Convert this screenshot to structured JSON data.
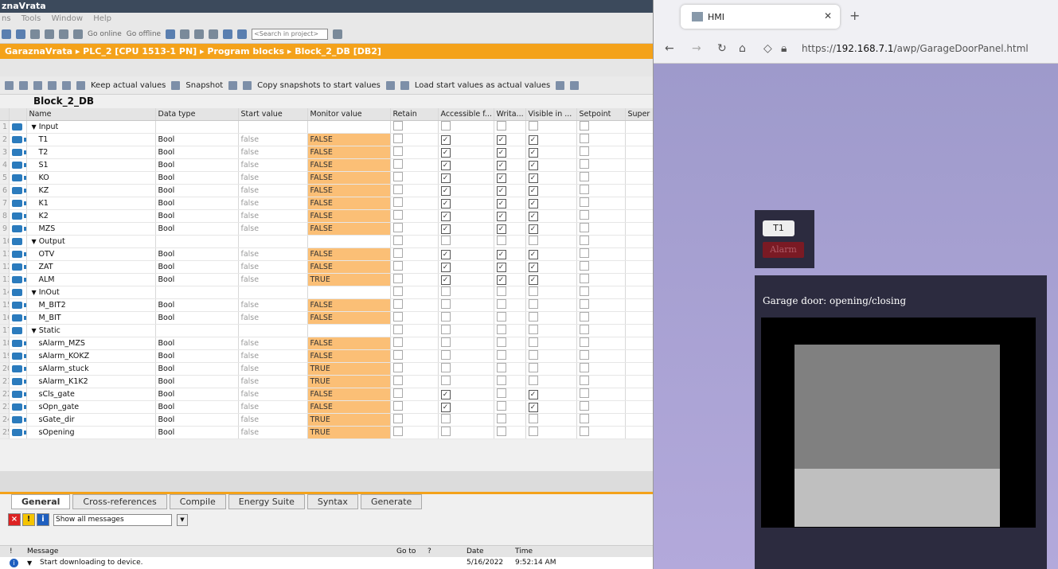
{
  "tia": {
    "title": "znaVrata",
    "menu": [
      "ns",
      "Tools",
      "Window",
      "Help"
    ],
    "toolbar": {
      "go_online": "Go online",
      "go_offline": "Go offline",
      "search_placeholder": "<Search in project>"
    },
    "breadcrumb": "GaraznaVrata ▸ PLC_2 [CPU 1513-1 PN] ▸ Program blocks ▸ Block_2_DB [DB2]",
    "db_toolbar": {
      "keep_actual": "Keep actual values",
      "snapshot": "Snapshot",
      "copy_snapshots": "Copy snapshots to start values",
      "load_start": "Load start values as actual values"
    },
    "block_name": "Block_2_DB",
    "columns": [
      "Name",
      "Data type",
      "Start value",
      "Monitor value",
      "Retain",
      "Accessible f...",
      "Writa...",
      "Visible in ...",
      "Setpoint",
      "Super"
    ],
    "rows": [
      {
        "n": "1",
        "name": "Input",
        "type": "",
        "start": "",
        "mon": "",
        "section": true,
        "acc": false,
        "wr": false,
        "vis": false
      },
      {
        "n": "2",
        "name": "T1",
        "type": "Bool",
        "start": "false",
        "mon": "FALSE",
        "section": false,
        "acc": true,
        "wr": true,
        "vis": true
      },
      {
        "n": "3",
        "name": "T2",
        "type": "Bool",
        "start": "false",
        "mon": "FALSE",
        "section": false,
        "acc": true,
        "wr": true,
        "vis": true
      },
      {
        "n": "4",
        "name": "S1",
        "type": "Bool",
        "start": "false",
        "mon": "FALSE",
        "section": false,
        "acc": true,
        "wr": true,
        "vis": true
      },
      {
        "n": "5",
        "name": "KO",
        "type": "Bool",
        "start": "false",
        "mon": "FALSE",
        "section": false,
        "acc": true,
        "wr": true,
        "vis": true
      },
      {
        "n": "6",
        "name": "KZ",
        "type": "Bool",
        "start": "false",
        "mon": "FALSE",
        "section": false,
        "acc": true,
        "wr": true,
        "vis": true
      },
      {
        "n": "7",
        "name": "K1",
        "type": "Bool",
        "start": "false",
        "mon": "FALSE",
        "section": false,
        "acc": true,
        "wr": true,
        "vis": true
      },
      {
        "n": "8",
        "name": "K2",
        "type": "Bool",
        "start": "false",
        "mon": "FALSE",
        "section": false,
        "acc": true,
        "wr": true,
        "vis": true
      },
      {
        "n": "9",
        "name": "MZS",
        "type": "Bool",
        "start": "false",
        "mon": "FALSE",
        "section": false,
        "acc": true,
        "wr": true,
        "vis": true
      },
      {
        "n": "10",
        "name": "Output",
        "type": "",
        "start": "",
        "mon": "",
        "section": true,
        "acc": false,
        "wr": false,
        "vis": false
      },
      {
        "n": "11",
        "name": "OTV",
        "type": "Bool",
        "start": "false",
        "mon": "FALSE",
        "section": false,
        "acc": true,
        "wr": true,
        "vis": true
      },
      {
        "n": "12",
        "name": "ZAT",
        "type": "Bool",
        "start": "false",
        "mon": "FALSE",
        "section": false,
        "acc": true,
        "wr": true,
        "vis": true
      },
      {
        "n": "13",
        "name": "ALM",
        "type": "Bool",
        "start": "false",
        "mon": "TRUE",
        "section": false,
        "acc": true,
        "wr": true,
        "vis": true
      },
      {
        "n": "14",
        "name": "InOut",
        "type": "",
        "start": "",
        "mon": "",
        "section": true,
        "acc": false,
        "wr": false,
        "vis": false
      },
      {
        "n": "15",
        "name": "M_BIT2",
        "type": "Bool",
        "start": "false",
        "mon": "FALSE",
        "section": false,
        "acc": false,
        "wr": false,
        "vis": false
      },
      {
        "n": "16",
        "name": "M_BIT",
        "type": "Bool",
        "start": "false",
        "mon": "FALSE",
        "section": false,
        "acc": false,
        "wr": false,
        "vis": false
      },
      {
        "n": "17",
        "name": "Static",
        "type": "",
        "start": "",
        "mon": "",
        "section": true,
        "acc": false,
        "wr": false,
        "vis": false
      },
      {
        "n": "18",
        "name": "sAlarm_MZS",
        "type": "Bool",
        "start": "false",
        "mon": "FALSE",
        "section": false,
        "acc": false,
        "wr": false,
        "vis": false
      },
      {
        "n": "19",
        "name": "sAlarm_KOKZ",
        "type": "Bool",
        "start": "false",
        "mon": "FALSE",
        "section": false,
        "acc": false,
        "wr": false,
        "vis": false
      },
      {
        "n": "20",
        "name": "sAlarm_stuck",
        "type": "Bool",
        "start": "false",
        "mon": "TRUE",
        "section": false,
        "acc": false,
        "wr": false,
        "vis": false
      },
      {
        "n": "21",
        "name": "sAlarm_K1K2",
        "type": "Bool",
        "start": "false",
        "mon": "TRUE",
        "section": false,
        "acc": false,
        "wr": false,
        "vis": false
      },
      {
        "n": "22",
        "name": "sCls_gate",
        "type": "Bool",
        "start": "false",
        "mon": "FALSE",
        "section": false,
        "acc": true,
        "wr": false,
        "vis": true
      },
      {
        "n": "23",
        "name": "sOpn_gate",
        "type": "Bool",
        "start": "false",
        "mon": "FALSE",
        "section": false,
        "acc": true,
        "wr": false,
        "vis": true
      },
      {
        "n": "24",
        "name": "sGate_dir",
        "type": "Bool",
        "start": "false",
        "mon": "TRUE",
        "section": false,
        "acc": false,
        "wr": false,
        "vis": false
      },
      {
        "n": "25",
        "name": "sOpening",
        "type": "Bool",
        "start": "false",
        "mon": "TRUE",
        "section": false,
        "acc": false,
        "wr": false,
        "vis": false
      }
    ],
    "bottom_tabs": [
      "General",
      "Cross-references",
      "Compile",
      "Energy Suite",
      "Syntax",
      "Generate"
    ],
    "message_filter": "Show all messages",
    "msg_columns": {
      "i": "!",
      "message": "Message",
      "goto": "Go to",
      "q": "?",
      "date": "Date",
      "time": "Time"
    },
    "msg_row": {
      "message": "Start downloading to device.",
      "date": "5/16/2022",
      "time": "9:52:14 AM"
    }
  },
  "browser": {
    "tab_title": "HMI",
    "url_prefix": "https://",
    "url_host": "192.168.7.1",
    "url_path": "/awp/GarageDoorPanel.html"
  },
  "hmi": {
    "t1_label": "T1",
    "alarm_label": "Alarm",
    "door_title": "Garage door: opening/closing",
    "door_open_fraction": 0.68
  },
  "colors": {
    "accent": "#f4a21a",
    "monitor": "#fbbf76",
    "hmi_bg": "#a9a2d6",
    "panel": "#2c2b3f"
  }
}
